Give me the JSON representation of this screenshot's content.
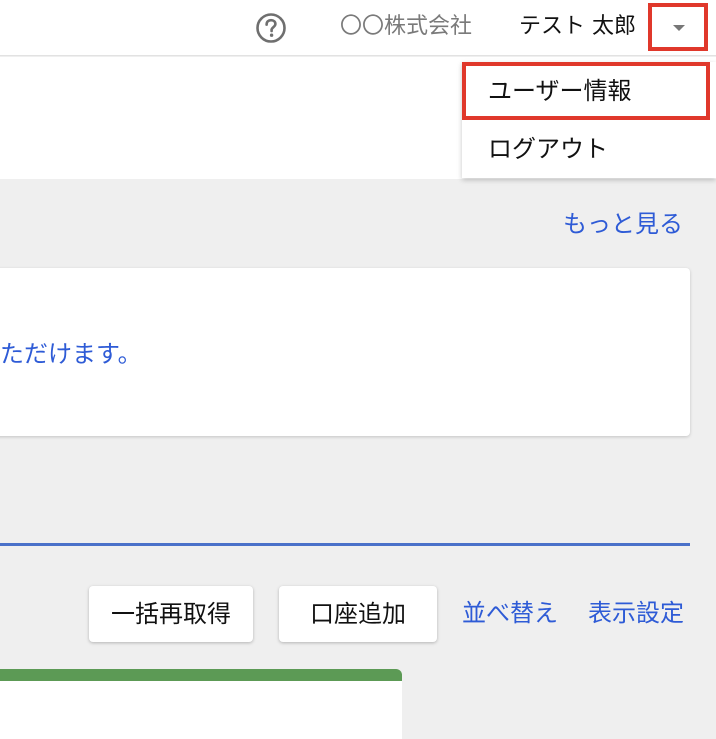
{
  "header": {
    "help_icon": "question-circle-icon",
    "company_name": "〇〇株式会社",
    "user_name": "テスト 太郎",
    "dropdown_icon": "caret-down-icon"
  },
  "dropdown_menu": {
    "items": [
      {
        "label": "ユーザー情報"
      },
      {
        "label": "ログアウト"
      }
    ]
  },
  "notice": {
    "more_link": "もっと見る",
    "text": "ただけます。"
  },
  "actions": {
    "bulk_refresh": "一括再取得",
    "add_account": "口座追加",
    "sort": "並べ替え",
    "display_settings": "表示設定"
  },
  "colors": {
    "accent_link": "#2e5bd6",
    "highlight_border": "#e0382b",
    "card_top_bar": "#5c9a55",
    "divider": "#4a71c9"
  }
}
